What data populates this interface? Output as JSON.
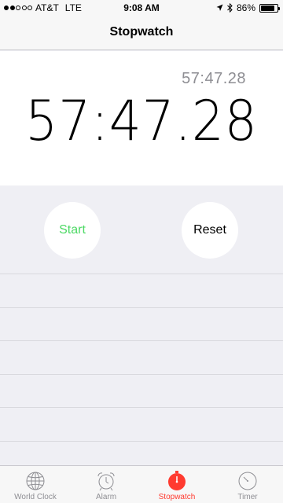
{
  "status_bar": {
    "carrier": "AT&T",
    "network": "LTE",
    "time": "9:08 AM",
    "battery": "86%",
    "battery_level": 0.86,
    "signal_bars_filled": 2,
    "signal_bars_total": 5
  },
  "nav": {
    "title": "Stopwatch"
  },
  "stopwatch": {
    "lap_time": "57:47.28",
    "main_time": "57:47.28"
  },
  "controls": {
    "start_label": "Start",
    "reset_label": "Reset",
    "start_color": "#4cd964"
  },
  "tabs": [
    {
      "label": "World Clock",
      "icon": "globe-icon",
      "active": false
    },
    {
      "label": "Alarm",
      "icon": "alarm-clock-icon",
      "active": false
    },
    {
      "label": "Stopwatch",
      "icon": "stopwatch-icon",
      "active": true
    },
    {
      "label": "Timer",
      "icon": "timer-icon",
      "active": false
    }
  ],
  "colors": {
    "accent": "#ff3b30",
    "inactive": "#8e8e93",
    "background": "#efeff4"
  }
}
